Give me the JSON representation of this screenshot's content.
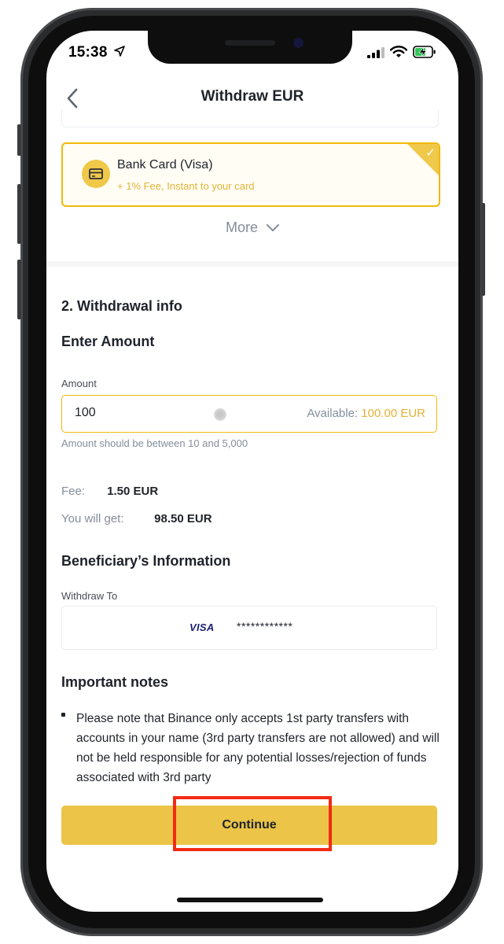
{
  "status_bar": {
    "time": "15:38"
  },
  "header": {
    "title": "Withdraw EUR"
  },
  "payment_method": {
    "name": "Bank Card (Visa)",
    "detail": "+ 1% Fee, Instant to your card",
    "selected": true
  },
  "more_label": "More",
  "withdrawal_info": {
    "section_title": "2. Withdrawal info",
    "enter_amount_title": "Enter Amount",
    "amount_label": "Amount",
    "amount_value": "100",
    "available_label": "Available:",
    "available_value": "100.00 EUR",
    "amount_hint": "Amount should be between 10 and 5,000",
    "fee_label": "Fee:",
    "fee_value": "1.50 EUR",
    "receive_label": "You will get:",
    "receive_value": "98.50 EUR"
  },
  "beneficiary": {
    "title": "Beneficiary’s Information",
    "withdraw_to_label": "Withdraw To",
    "card_brand": "VISA",
    "card_number_masked": "************"
  },
  "notes": {
    "title": "Important notes",
    "items": [
      "Please note that Binance only accepts 1st party transfers with accounts in your name (3rd party transfers are not allowed) and will not be held responsible for any potential losses/rejection of funds associated with 3rd party"
    ]
  },
  "continue_label": "Continue",
  "colors": {
    "accent": "#f0b90b",
    "button": "#ebc448",
    "highlight": "#f22b13"
  }
}
